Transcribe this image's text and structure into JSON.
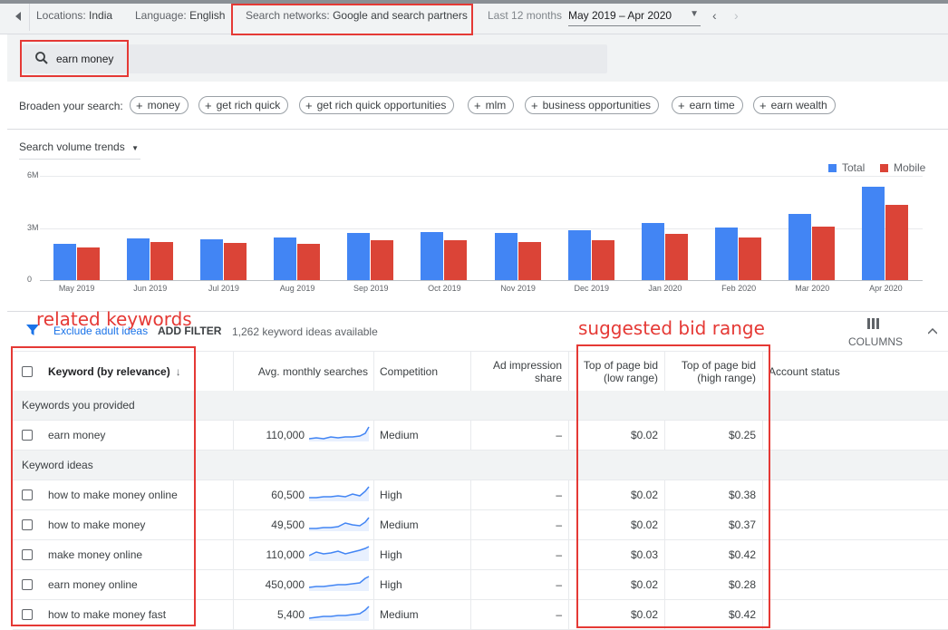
{
  "topbar": {
    "back_icon": "chevron-left-icon",
    "locations_label": "Locations:",
    "locations_value": "India",
    "language_label": "Language:",
    "language_value": "English",
    "networks_label": "Search networks:",
    "networks_value": "Google and search partners",
    "period_label": "Last 12 months",
    "date_range": "May 2019 – Apr 2020"
  },
  "search": {
    "icon": "search-icon",
    "value": "earn money"
  },
  "broaden": {
    "label": "Broaden your search:",
    "chips": [
      "money",
      "get rich quick",
      "get rich quick opportunities",
      "mlm",
      "business opportunities",
      "earn time",
      "earn wealth"
    ]
  },
  "trends": {
    "select_label": "Search volume trends"
  },
  "chart_data": {
    "type": "bar",
    "categories": [
      "May 2019",
      "Jun 2019",
      "Jul 2019",
      "Aug 2019",
      "Sep 2019",
      "Oct 2019",
      "Nov 2019",
      "Dec 2019",
      "Jan 2020",
      "Feb 2020",
      "Mar 2020",
      "Apr 2020"
    ],
    "series": [
      {
        "name": "Total",
        "color": "#4285f4",
        "values": [
          2.1,
          2.4,
          2.35,
          2.45,
          2.7,
          2.75,
          2.7,
          2.85,
          3.3,
          3.05,
          3.8,
          5.35
        ]
      },
      {
        "name": "Mobile",
        "color": "#db4437",
        "values": [
          1.9,
          2.2,
          2.15,
          2.1,
          2.3,
          2.3,
          2.2,
          2.3,
          2.65,
          2.45,
          3.1,
          4.35
        ]
      }
    ],
    "ylim": [
      0,
      6
    ],
    "yticks": [
      "0",
      "3M",
      "6M"
    ],
    "ytick_values": [
      0,
      3,
      6
    ],
    "legend_position": "top-right"
  },
  "toolbar": {
    "filter_chip": "Exclude adult ideas",
    "add_filter": "ADD FILTER",
    "ideas_count": "1,262 keyword ideas available",
    "columns": "COLUMNS"
  },
  "table": {
    "headers": {
      "keyword": "Keyword (by relevance)",
      "avg": "Avg. monthly searches",
      "competition": "Competition",
      "impression1": "Ad impression",
      "impression2": "share",
      "bidlow1": "Top of page bid",
      "bidlow2": "(low range)",
      "bidhigh1": "Top of page bid",
      "bidhigh2": "(high range)",
      "status": "Account status"
    },
    "group_provided": "Keywords you provided",
    "group_ideas": "Keyword ideas",
    "provided": [
      {
        "keyword": "earn money",
        "avg": "110,000",
        "competition": "Medium",
        "impression": "–",
        "bid_low": "$0.02",
        "bid_high": "$0.25"
      }
    ],
    "ideas": [
      {
        "keyword": "how to make money online",
        "avg": "60,500",
        "competition": "High",
        "impression": "–",
        "bid_low": "$0.02",
        "bid_high": "$0.38"
      },
      {
        "keyword": "how to make money",
        "avg": "49,500",
        "competition": "Medium",
        "impression": "–",
        "bid_low": "$0.02",
        "bid_high": "$0.37"
      },
      {
        "keyword": "make money online",
        "avg": "110,000",
        "competition": "High",
        "impression": "–",
        "bid_low": "$0.03",
        "bid_high": "$0.42"
      },
      {
        "keyword": "earn money online",
        "avg": "450,000",
        "competition": "High",
        "impression": "–",
        "bid_low": "$0.02",
        "bid_high": "$0.28"
      },
      {
        "keyword": "how to make money fast",
        "avg": "5,400",
        "competition": "Medium",
        "impression": "–",
        "bid_low": "$0.02",
        "bid_high": "$0.42"
      }
    ]
  },
  "annotations": {
    "related": "related keywords",
    "suggested": "suggested bid range",
    "color": "#e53935"
  }
}
